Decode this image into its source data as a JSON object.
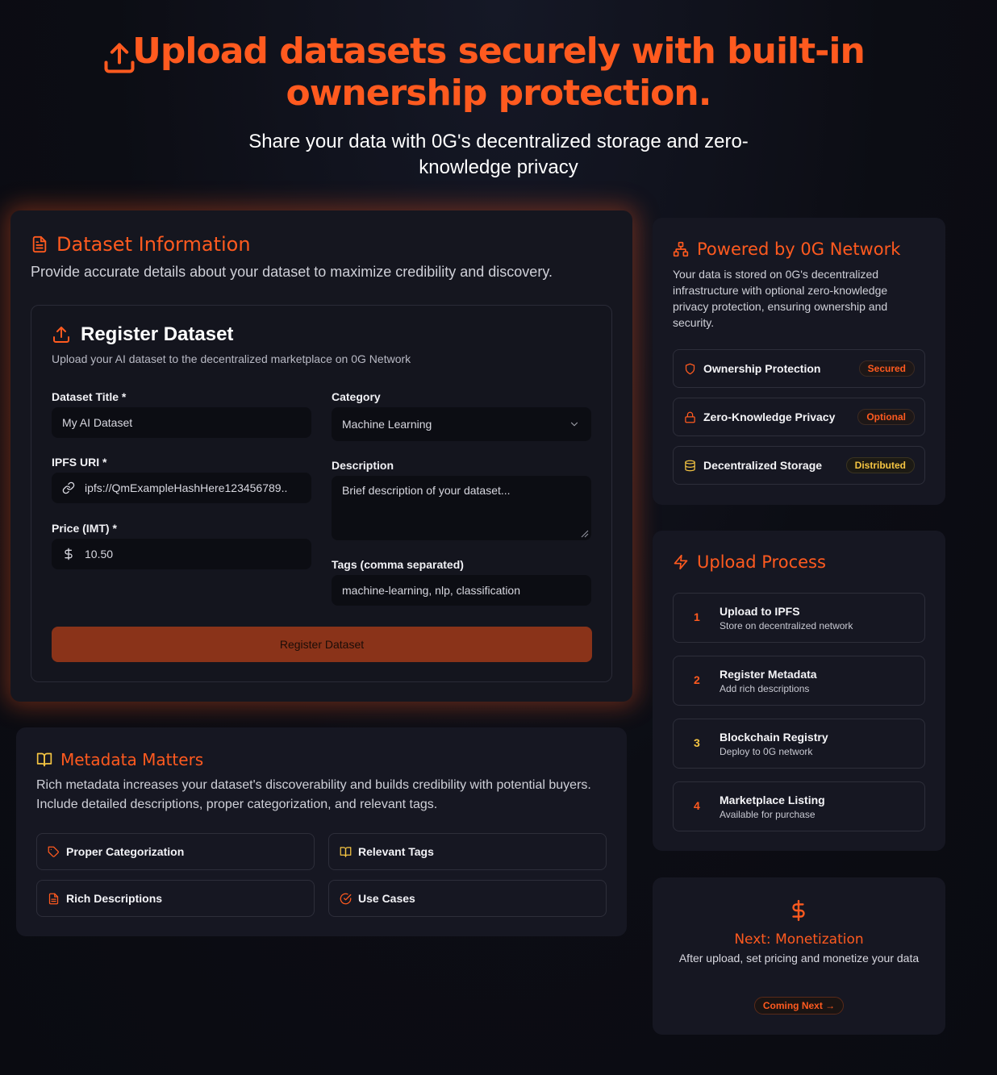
{
  "hero": {
    "title": "Upload datasets securely with built-in ownership protection.",
    "subtitle": "Share your data with 0G's decentralized storage and zero-knowledge privacy"
  },
  "info": {
    "title": "Dataset Information",
    "description": "Provide accurate details about your dataset to maximize credibility and discovery.",
    "form": {
      "title": "Register Dataset",
      "subtitle": "Upload your AI dataset to the decentralized marketplace on 0G Network",
      "dataset_title_label": "Dataset Title *",
      "dataset_title_placeholder": "My AI Dataset",
      "category_label": "Category",
      "category_value": "Machine Learning",
      "ipfs_label": "IPFS URI *",
      "ipfs_placeholder": "ipfs://QmExampleHashHere123456789..",
      "description_label": "Description",
      "description_placeholder": "Brief description of your dataset...",
      "price_label": "Price (IMT) *",
      "price_value": "10.50",
      "tags_label": "Tags (comma separated)",
      "tags_placeholder": "machine-learning, nlp, classification",
      "submit_label": "Register Dataset"
    }
  },
  "metadata": {
    "title": "Metadata Matters",
    "description": "Rich metadata increases your dataset's discoverability and builds credibility with potential buyers. Include detailed descriptions, proper categorization, and relevant tags.",
    "chips": [
      "Proper Categorization",
      "Relevant Tags",
      "Rich Descriptions",
      "Use Cases"
    ]
  },
  "powered": {
    "title": "Powered by 0G Network",
    "description": "Your data is stored on 0G's decentralized infrastructure with optional zero-knowledge privacy protection, ensuring ownership and security.",
    "features": [
      {
        "label": "Ownership Protection",
        "badge": "Secured",
        "color": "#ff5a1f"
      },
      {
        "label": "Zero-Knowledge Privacy",
        "badge": "Optional",
        "color": "#ff5a1f"
      },
      {
        "label": "Decentralized Storage",
        "badge": "Distributed",
        "color": "#f5c542"
      }
    ]
  },
  "process": {
    "title": "Upload Process",
    "steps": [
      {
        "num": "1",
        "title": "Upload to IPFS",
        "desc": "Store on decentralized network",
        "color": "#ff5a1f"
      },
      {
        "num": "2",
        "title": "Register Metadata",
        "desc": "Add rich descriptions",
        "color": "#ff5a1f"
      },
      {
        "num": "3",
        "title": "Blockchain Registry",
        "desc": "Deploy to 0G network",
        "color": "#f5c542"
      },
      {
        "num": "4",
        "title": "Marketplace Listing",
        "desc": "Available for purchase",
        "color": "#ff5a1f"
      }
    ]
  },
  "next": {
    "title": "Next: Monetization",
    "description": "After upload, set pricing and monetize your data",
    "button": "Coming Next →"
  },
  "colors": {
    "accent": "#ff5a1f",
    "gold": "#f5c542",
    "background": "#0c0d14",
    "card": "#161722"
  }
}
